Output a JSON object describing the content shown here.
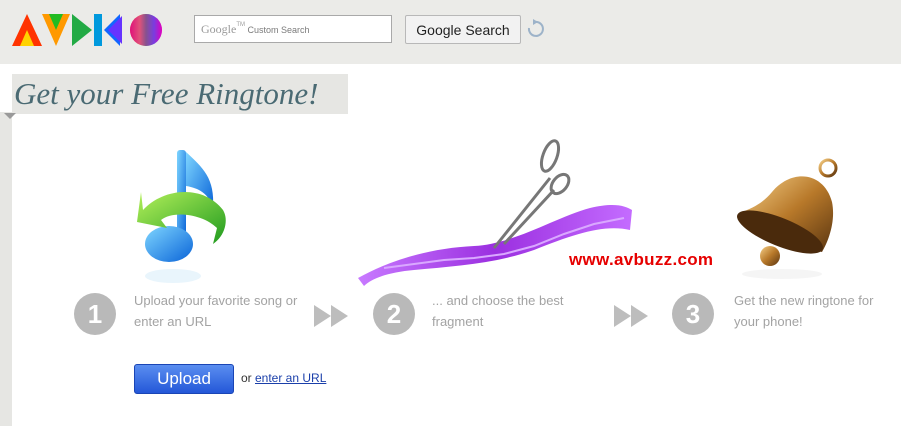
{
  "header": {
    "search": {
      "placeholder_brand": "Google",
      "placeholder_tm": "TM",
      "placeholder_text": "Custom Search"
    },
    "search_button_label": "Google Search"
  },
  "title": "Get your Free Ringtone!",
  "steps": [
    {
      "number": "1",
      "text": "Upload your favorite song or enter an URL"
    },
    {
      "number": "2",
      "text": "... and choose the best fragment"
    },
    {
      "number": "3",
      "text": "Get the new ringtone for your phone!"
    }
  ],
  "watermark": "www.avbuzz.com",
  "upload_button_label": "Upload",
  "or_label": "or",
  "enter_url_link": "enter an URL",
  "colors": {
    "accent_blue": "#2457d8",
    "title_color": "#4a6a73",
    "step_circle": "#b9b9b9",
    "watermark_red": "#e60000"
  }
}
